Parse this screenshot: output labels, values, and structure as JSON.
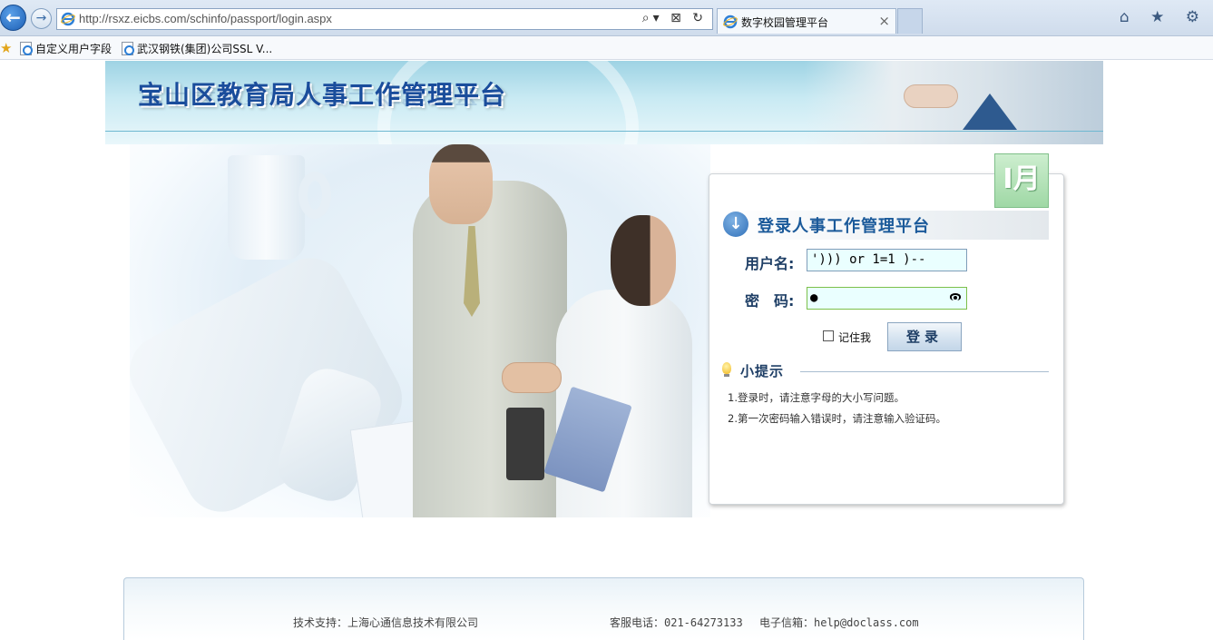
{
  "browser": {
    "url": "http://rsxz.eicbs.com/schinfo/passport/login.aspx",
    "tab_title": "数字校园管理平台",
    "tab_close": "×",
    "address_tools": "⌕▾ ⊠ ↻",
    "chrome_icons": "⌂ ★ ⚙",
    "favorites": [
      {
        "label": "自定义用户字段"
      },
      {
        "label": "武汉钢铁(集团)公司SSL V..."
      }
    ]
  },
  "banner": {
    "title": "宝山区教育局人事工作管理平台"
  },
  "login": {
    "badge_text": "I月",
    "title": "登录人事工作管理平台",
    "username_label": "用户名:",
    "username_value": "'))) or 1=1 )--",
    "password_label": "密　码:",
    "password_value": "●",
    "remember_label": "记住我",
    "submit_label": "登录",
    "tips_title": "小提示",
    "tips": [
      "1.登录时，请注意字母的大小写问题。",
      "2.第一次密码输入错误时，请注意输入验证码。"
    ]
  },
  "footer": {
    "support": "技术支持：上海心通信息技术有限公司",
    "phone": "客服电话：021-64273133",
    "email": "电子信箱：help@doclass.com"
  },
  "colors": {
    "title_blue": "#1a4d9c",
    "input_bg": "#eaffff",
    "badge_green": "#9fd8a5"
  }
}
